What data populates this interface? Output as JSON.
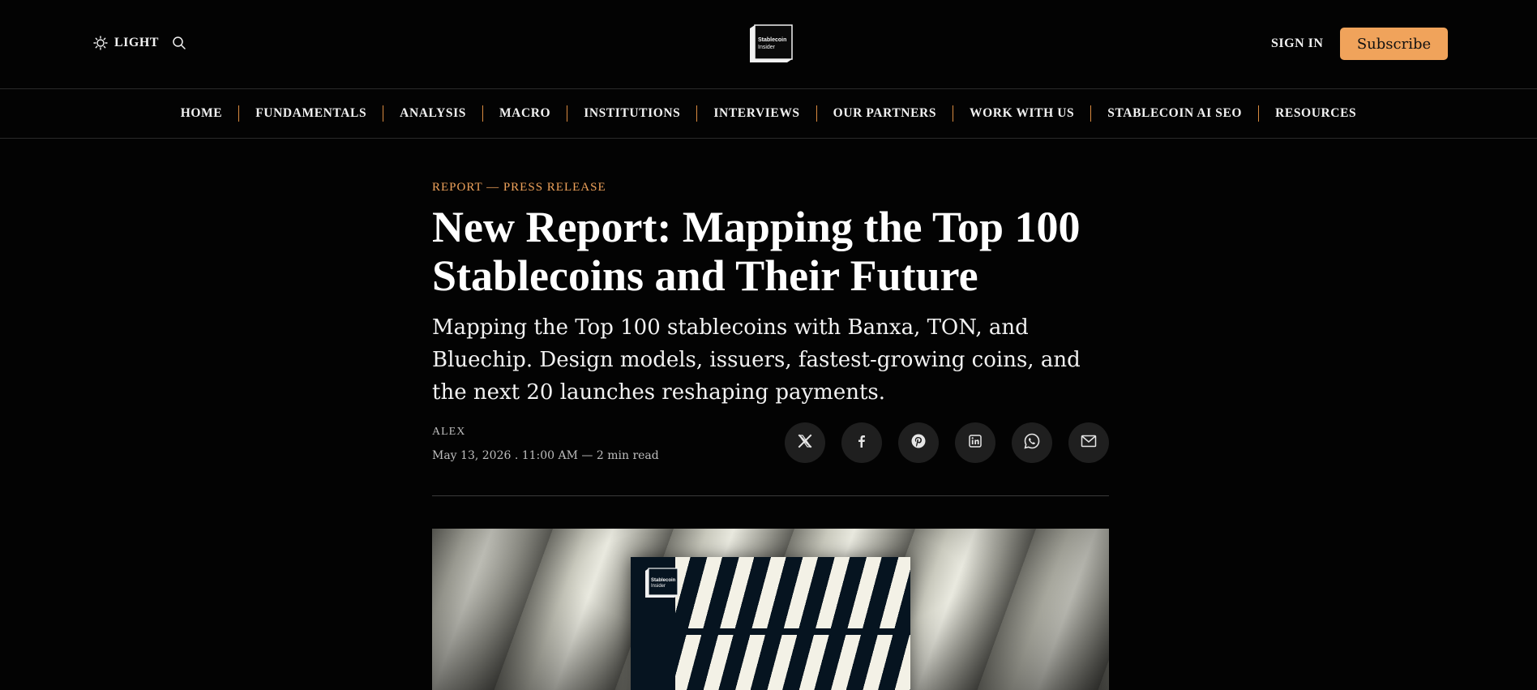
{
  "header": {
    "theme_label": "LIGHT",
    "logo_text_line1": "Stablecoin",
    "logo_text_line2": "Insider",
    "signin_label": "SIGN IN",
    "subscribe_label": "Subscribe"
  },
  "nav": {
    "items": [
      {
        "label": "HOME"
      },
      {
        "label": "FUNDAMENTALS"
      },
      {
        "label": "ANALYSIS"
      },
      {
        "label": "MACRO"
      },
      {
        "label": "INSTITUTIONS"
      },
      {
        "label": "INTERVIEWS"
      },
      {
        "label": "OUR PARTNERS"
      },
      {
        "label": "WORK WITH US"
      },
      {
        "label": "STABLECOIN AI SEO"
      },
      {
        "label": "RESOURCES"
      }
    ]
  },
  "article": {
    "eyebrow": "REPORT — PRESS RELEASE",
    "title_line1": "New Report: Mapping the Top 100",
    "title_line2": "Stablecoins and Their Future",
    "subtitle": "Mapping the Top 100 stablecoins with Banxa, TON, and Bluechip. Design models, issuers, fastest-growing coins, and the next 20 launches reshaping payments.",
    "author": "ALEX",
    "meta": "May 13, 2026 . 11:00 AM — 2 min read"
  },
  "share": [
    "x-icon",
    "facebook-icon",
    "pinterest-icon",
    "linkedin-icon",
    "whatsapp-icon",
    "email-icon"
  ],
  "colors": {
    "accent": "#f0a35b",
    "background": "#030303"
  }
}
